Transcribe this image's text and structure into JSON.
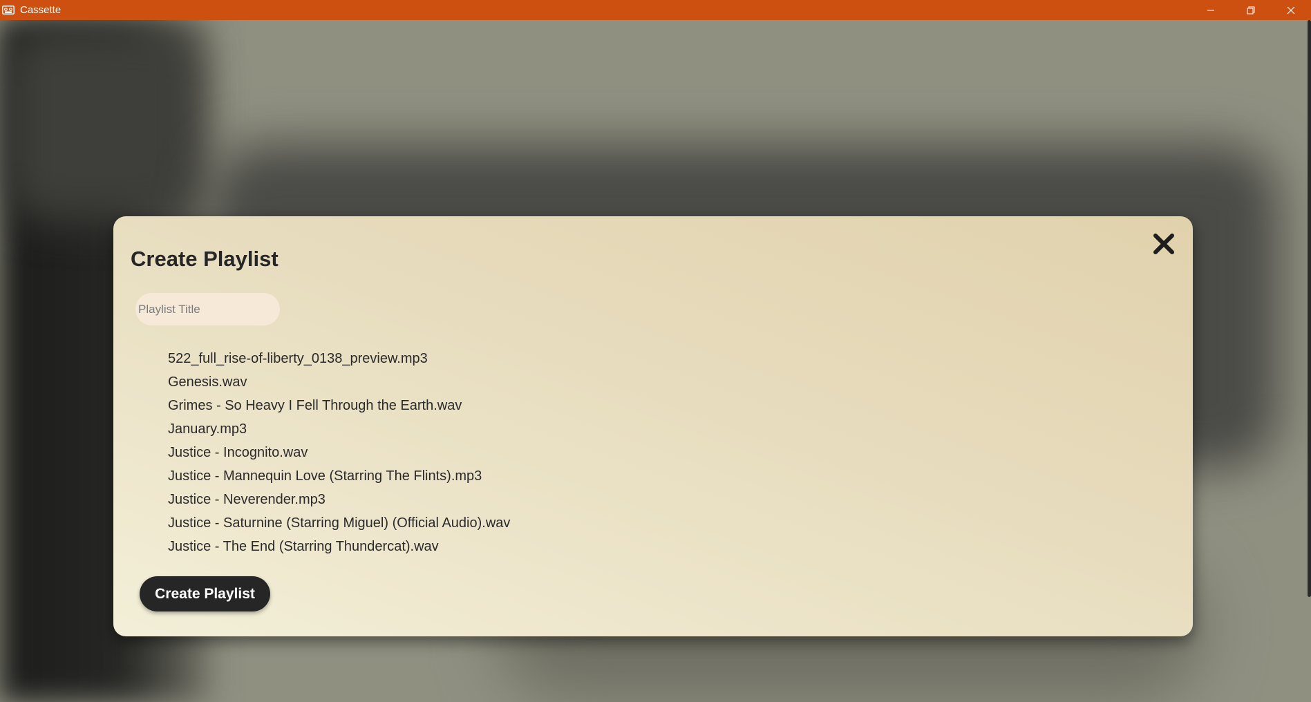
{
  "window": {
    "title": "Cassette",
    "icon": "cassette-icon",
    "controls": [
      "minimize-icon",
      "restore-icon",
      "close-icon"
    ],
    "accent_color": "#cd5010"
  },
  "modal": {
    "title": "Create Playlist",
    "close_icon": "close-x-icon",
    "input": {
      "placeholder": "Playlist Title",
      "value": ""
    },
    "files": [
      "522_full_rise-of-liberty_0138_preview.mp3",
      "Genesis.wav",
      "Grimes - So Heavy I Fell Through the Earth.wav",
      "January.mp3",
      "Justice - Incognito.wav",
      "Justice - Mannequin Love (Starring The Flints).mp3",
      "Justice - Neverender.mp3",
      "Justice - Saturnine (Starring Miguel) (Official Audio).wav",
      "Justice - The End (Starring Thundercat).wav"
    ],
    "submit_label": "Create Playlist"
  }
}
